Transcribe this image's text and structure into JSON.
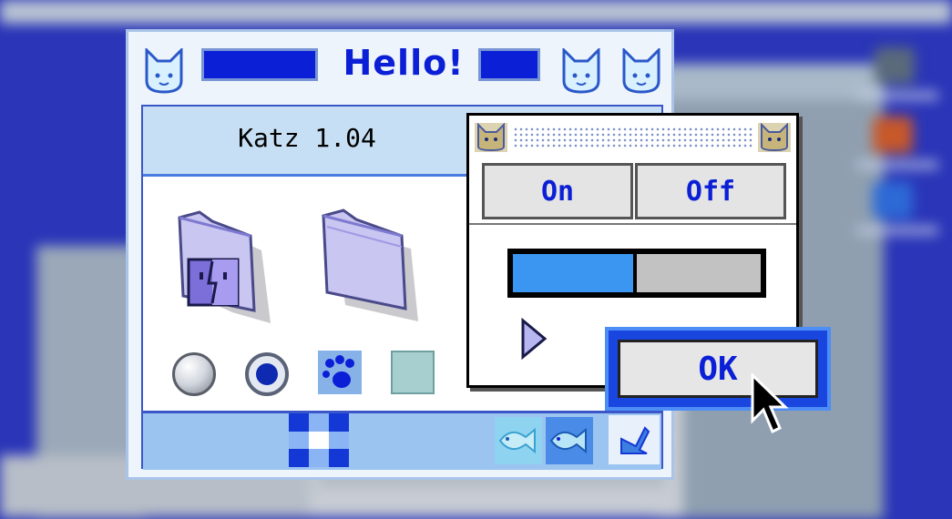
{
  "window": {
    "title": "Hello!",
    "app_name": "Katz 1.04"
  },
  "dialog": {
    "on_label": "On",
    "off_label": "Off",
    "slider_level": 0.5,
    "ok_label": "OK"
  },
  "colors": {
    "accent_blue": "#0a1fd6",
    "window_bg": "#eef4fb",
    "header_strip": "#c6dff4",
    "bottom_bar": "#9cc4f0",
    "slider_fill": "#3a96f0",
    "desktop": "#2a35b8"
  },
  "icons": {
    "title_left": "cat-face-icon",
    "title_right": [
      "cat-face-icon",
      "cat-face-icon"
    ],
    "content": [
      "finder-folder-icon",
      "folder-icon",
      "radio-unselected",
      "radio-selected",
      "paw-print-icon",
      "teal-square-icon"
    ],
    "bottom_bar": [
      "checkerboard-icon",
      "fish-icon",
      "fish-icon",
      "resize-grip-icon"
    ]
  }
}
